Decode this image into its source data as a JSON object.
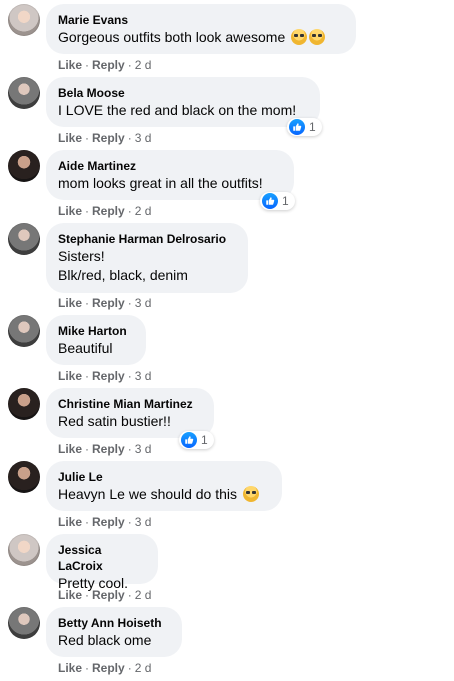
{
  "comments": [
    {
      "author": "Marie Evans",
      "text": "Gorgeous outfits both look awesome",
      "emoji": [
        "grinning-sunglasses-emoji",
        "grinning-sunglasses-emoji"
      ],
      "like_label": "Like",
      "reply_label": "Reply",
      "age": "2 d"
    },
    {
      "author": "Bela Moose",
      "text": "I LOVE the red and black on the mom!",
      "like_label": "Like",
      "reply_label": "Reply",
      "age": "3 d",
      "reaction_count": "1"
    },
    {
      "author": "Aide Martinez",
      "text": "mom looks great in all the outfits!",
      "like_label": "Like",
      "reply_label": "Reply",
      "age": "2 d",
      "reaction_count": "1"
    },
    {
      "author": "Stephanie Harman Delrosario",
      "text_lines": [
        "Sisters!",
        "Blk/red, black, denim"
      ],
      "like_label": "Like",
      "reply_label": "Reply",
      "age": "3 d"
    },
    {
      "author": "Mike Harton",
      "text": "Beautiful",
      "like_label": "Like",
      "reply_label": "Reply",
      "age": "3 d"
    },
    {
      "author": "Christine Mian Martinez",
      "text": "Red satin bustier!!",
      "like_label": "Like",
      "reply_label": "Reply",
      "age": "3 d",
      "reaction_count": "1"
    },
    {
      "author": "Julie Le",
      "mention": "Heavyn Le",
      "text": " we should do this",
      "emoji": [
        "laughing-emoji"
      ],
      "like_label": "Like",
      "reply_label": "Reply",
      "age": "3 d"
    },
    {
      "author": "Jessica LaCroix",
      "text": "Pretty cool.",
      "like_label": "Like",
      "reply_label": "Reply",
      "age": "2 d"
    },
    {
      "author": "Betty Ann Hoiseth",
      "text": "Red black ome",
      "like_label": "Like",
      "reply_label": "Reply",
      "age": "2 d"
    }
  ],
  "separator": "·",
  "colors": {
    "bubble": "#f0f2f5",
    "meta_text": "#65676b",
    "like_blue": "#0866ff"
  }
}
